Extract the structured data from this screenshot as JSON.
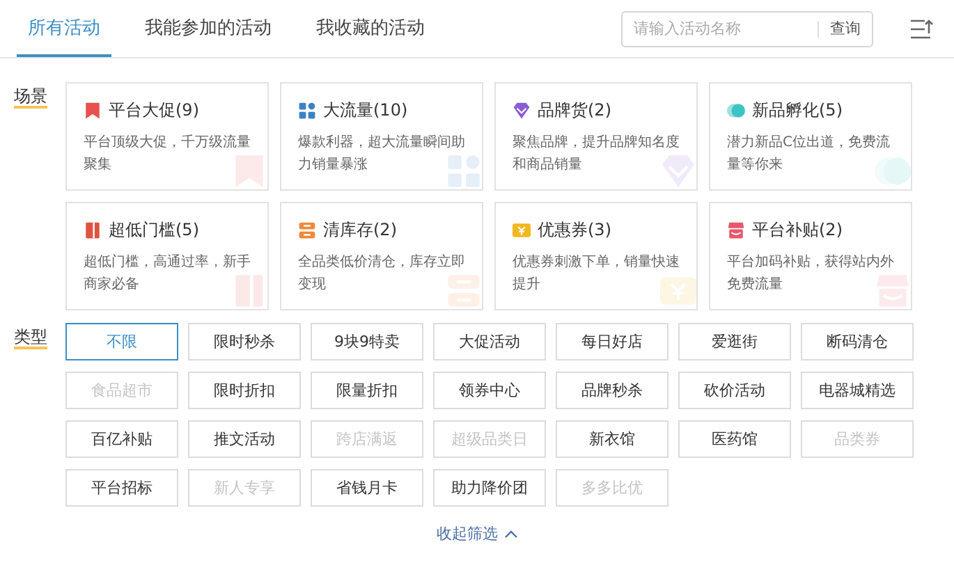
{
  "tabs": [
    {
      "label": "所有活动",
      "selected": true
    },
    {
      "label": "我能参加的活动",
      "selected": false
    },
    {
      "label": "我收藏的活动",
      "selected": false
    }
  ],
  "search": {
    "placeholder": "请输入活动名称",
    "button": "查询"
  },
  "scene": {
    "label": "场景",
    "cards": [
      {
        "kind": "flag",
        "color": "#e8514f",
        "title": "平台大促(9)",
        "desc": "平台顶级大促，千万级流量聚集"
      },
      {
        "kind": "blocks",
        "color": "#3b82c4",
        "title": "大流量(10)",
        "desc": "爆款利器，超大流量瞬间助力销量暴涨"
      },
      {
        "kind": "diamond",
        "color": "#8a5cd6",
        "title": "品牌货(2)",
        "desc": "聚焦品牌，提升品牌知名度和商品销量"
      },
      {
        "kind": "toggle",
        "color": "#3cc4c4",
        "title": "新品孵化(5)",
        "desc": "潜力新品C位出道，免费流量等你来"
      },
      {
        "kind": "door",
        "color": "#e0533f",
        "title": "超低门槛(5)",
        "desc": "超低门槛，高通过率，新手商家必备"
      },
      {
        "kind": "stack",
        "color": "#f0883a",
        "title": "清库存(2)",
        "desc": "全品类低价清仓，库存立即变现"
      },
      {
        "kind": "coupon",
        "color": "#f2b81f",
        "title": "优惠券(3)",
        "desc": "优惠券刺激下单，销量快速提升"
      },
      {
        "kind": "shop",
        "color": "#e8576a",
        "title": "平台补贴(2)",
        "desc": "平台加码补贴，获得站内外免费流量"
      }
    ]
  },
  "type": {
    "label": "类型",
    "options": [
      {
        "label": "不限",
        "selected": true,
        "disabled": false
      },
      {
        "label": "限时秒杀",
        "selected": false,
        "disabled": false
      },
      {
        "label": "9块9特卖",
        "selected": false,
        "disabled": false
      },
      {
        "label": "大促活动",
        "selected": false,
        "disabled": false
      },
      {
        "label": "每日好店",
        "selected": false,
        "disabled": false
      },
      {
        "label": "爱逛街",
        "selected": false,
        "disabled": false
      },
      {
        "label": "断码清仓",
        "selected": false,
        "disabled": false
      },
      {
        "label": "食品超市",
        "selected": false,
        "disabled": true
      },
      {
        "label": "限时折扣",
        "selected": false,
        "disabled": false
      },
      {
        "label": "限量折扣",
        "selected": false,
        "disabled": false
      },
      {
        "label": "领券中心",
        "selected": false,
        "disabled": false
      },
      {
        "label": "品牌秒杀",
        "selected": false,
        "disabled": false
      },
      {
        "label": "砍价活动",
        "selected": false,
        "disabled": false
      },
      {
        "label": "电器城精选",
        "selected": false,
        "disabled": false
      },
      {
        "label": "百亿补贴",
        "selected": false,
        "disabled": false
      },
      {
        "label": "推文活动",
        "selected": false,
        "disabled": false
      },
      {
        "label": "跨店满返",
        "selected": false,
        "disabled": true
      },
      {
        "label": "超级品类日",
        "selected": false,
        "disabled": true
      },
      {
        "label": "新衣馆",
        "selected": false,
        "disabled": false
      },
      {
        "label": "医药馆",
        "selected": false,
        "disabled": false
      },
      {
        "label": "品类券",
        "selected": false,
        "disabled": true
      },
      {
        "label": "平台招标",
        "selected": false,
        "disabled": false
      },
      {
        "label": "新人专享",
        "selected": false,
        "disabled": true
      },
      {
        "label": "省钱月卡",
        "selected": false,
        "disabled": false
      },
      {
        "label": "助力降价团",
        "selected": false,
        "disabled": false
      },
      {
        "label": "多多比优",
        "selected": false,
        "disabled": true
      }
    ]
  },
  "collapse": {
    "label": "收起筛选"
  }
}
